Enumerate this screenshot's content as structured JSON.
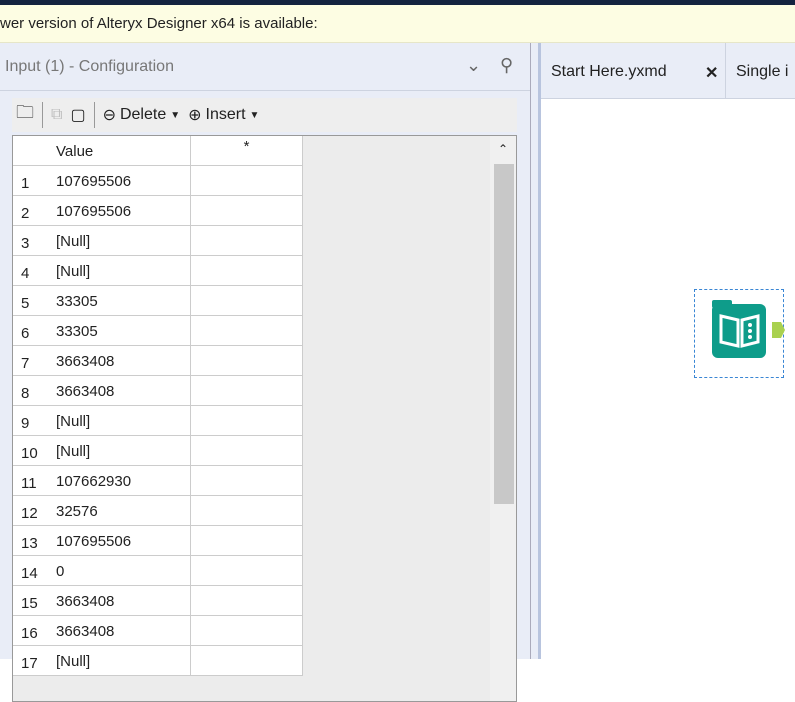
{
  "notice": "wer version of Alteryx Designer x64 is available:",
  "panel": {
    "title": "Input (1) - Configuration",
    "toolbar": {
      "delete": "Delete",
      "insert": "Insert"
    }
  },
  "grid": {
    "headers": [
      "Value",
      "*"
    ],
    "rows": [
      [
        "1",
        "107695506"
      ],
      [
        "2",
        "107695506"
      ],
      [
        "3",
        "[Null]"
      ],
      [
        "4",
        "[Null]"
      ],
      [
        "5",
        "33305"
      ],
      [
        "6",
        "33305"
      ],
      [
        "7",
        "3663408"
      ],
      [
        "8",
        "3663408"
      ],
      [
        "9",
        "[Null]"
      ],
      [
        "10",
        "[Null]"
      ],
      [
        "11",
        "107662930"
      ],
      [
        "12",
        "32576"
      ],
      [
        "13",
        "107695506"
      ],
      [
        "14",
        "0"
      ],
      [
        "15",
        "3663408"
      ],
      [
        "16",
        "3663408"
      ],
      [
        "17",
        "[Null]"
      ]
    ]
  },
  "tabs": [
    {
      "label": "Start Here.yxmd"
    },
    {
      "label": "Single i"
    }
  ],
  "colors": {
    "accent": "#0e9c8a",
    "panel": "#e9edf7"
  }
}
